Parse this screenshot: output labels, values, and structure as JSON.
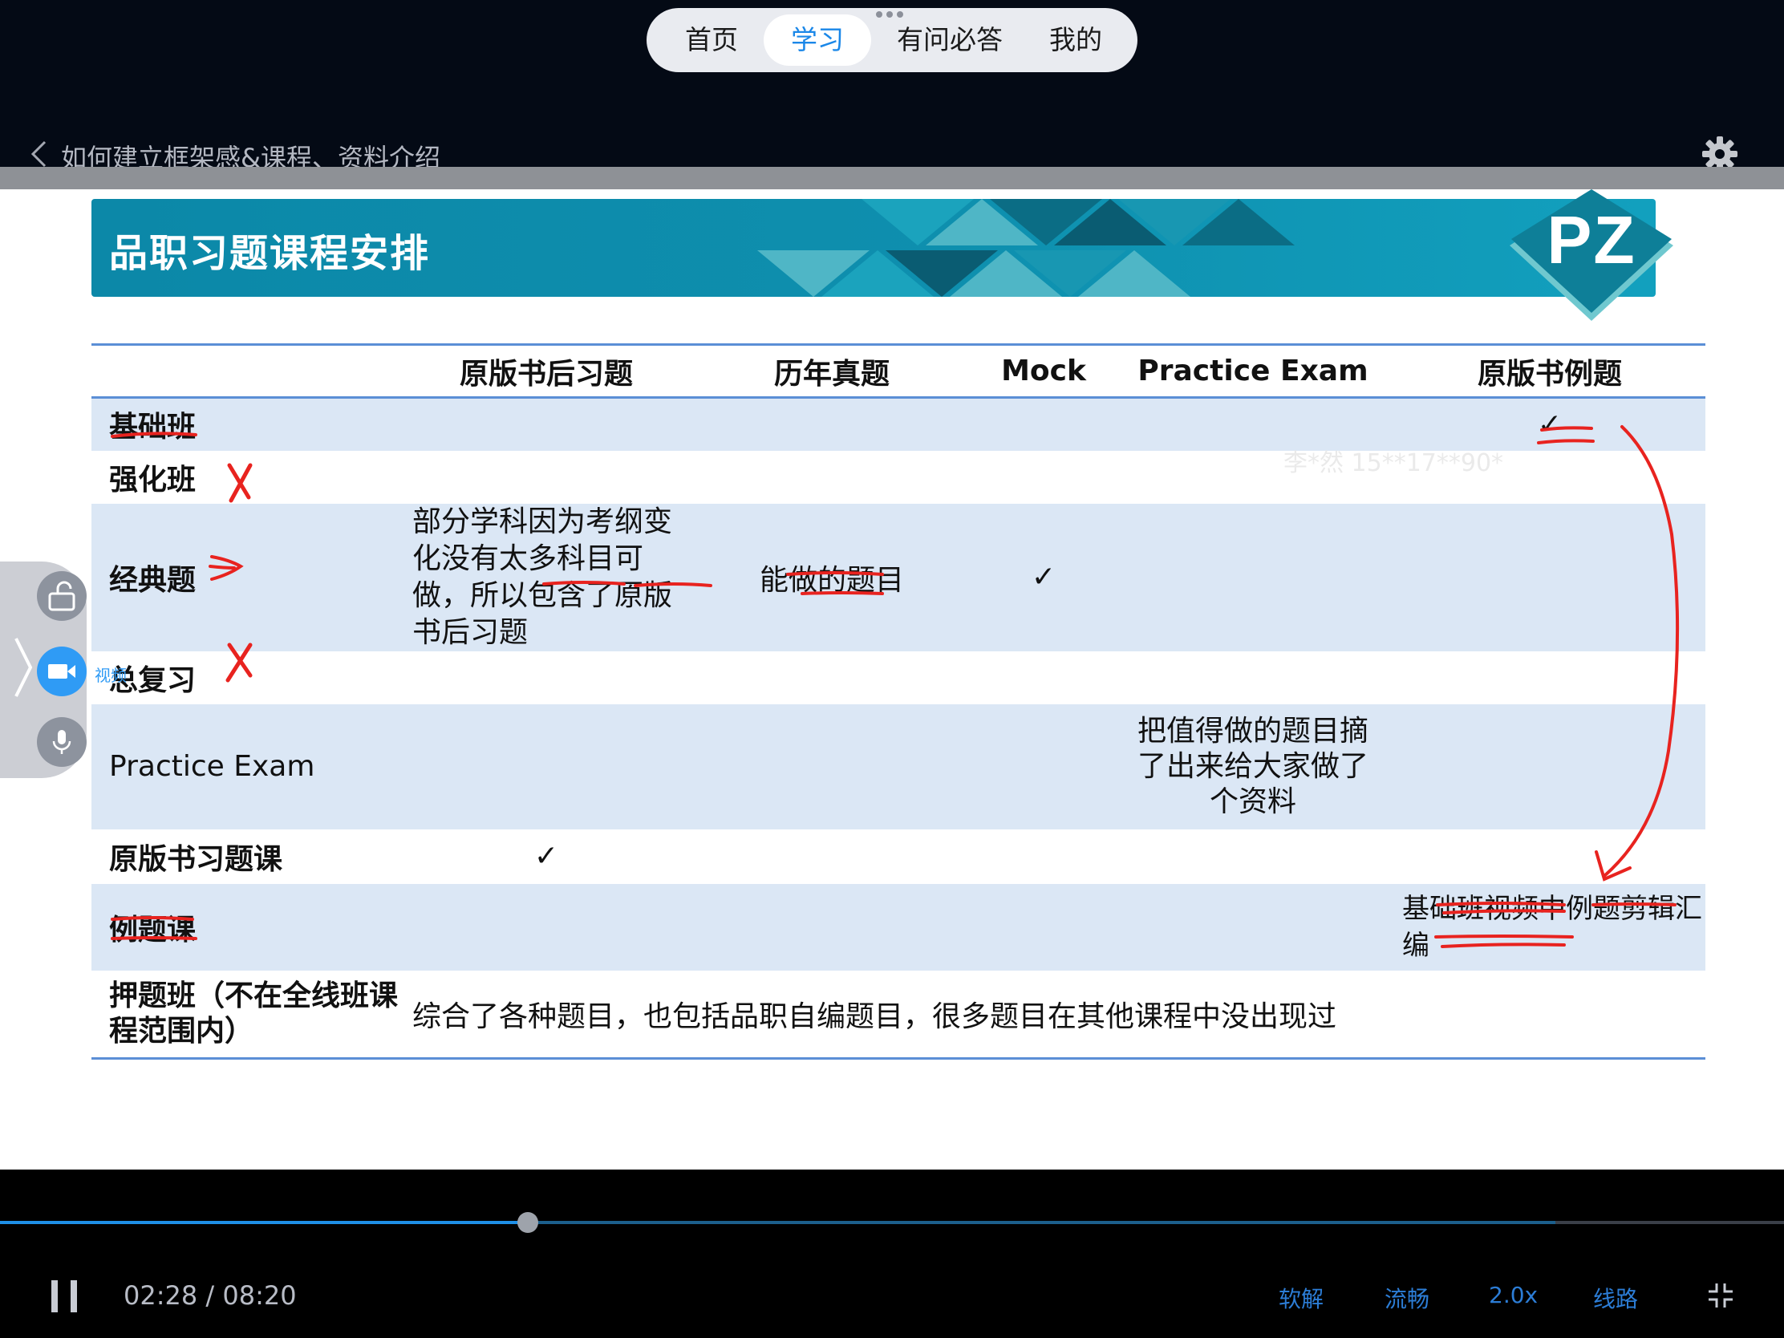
{
  "topnav": {
    "tabs": [
      {
        "label": "首页",
        "active": false
      },
      {
        "label": "学习",
        "active": true
      },
      {
        "label": "有问必答",
        "active": false
      },
      {
        "label": "我的",
        "active": false
      }
    ],
    "active_color": "#1a87e8"
  },
  "header": {
    "title": "如何建立框架感&课程、资料介绍",
    "back_icon": "chevron-left-icon",
    "settings_icon": "gear-icon"
  },
  "slide": {
    "banner_title": "品职习题课程安排",
    "logo_text": "PZ",
    "watermark": "李*然 15**17**90*",
    "columns": [
      "",
      "原版书后习题",
      "历年真题",
      "Mock",
      "Practice Exam",
      "原版书例题"
    ],
    "rows": [
      {
        "label": "基础班",
        "cells": [
          "",
          "",
          "",
          "",
          "✓"
        ]
      },
      {
        "label": "强化班",
        "cells": [
          "",
          "",
          "",
          "",
          ""
        ]
      },
      {
        "label": "经典题",
        "cells": [
          "部分学科因为考纲变化没有太多科目可做，所以包含了原版书后习题",
          "能做的题目",
          "✓",
          "",
          ""
        ]
      },
      {
        "label": "总复习",
        "cells": [
          "",
          "",
          "",
          "",
          ""
        ]
      },
      {
        "label": "Practice Exam",
        "cells": [
          "",
          "",
          "",
          "把值得做的题目摘了出来给大家做了个资料",
          ""
        ]
      },
      {
        "label": "原版书习题课",
        "cells": [
          "✓",
          "",
          "",
          "",
          ""
        ]
      },
      {
        "label": "例题课",
        "cells": [
          "",
          "",
          "",
          "",
          "基础班视频中例题剪辑汇编"
        ]
      },
      {
        "label": "押题班（不在全线班课程范围内）",
        "cells": [
          "综合了各种题目，也包括品职自编题目，很多题目在其他课程中没出现过"
        ]
      }
    ],
    "annotation_color": "#e8231f",
    "accent_color": "#0e8fae"
  },
  "sidetools": {
    "video_label": "视频",
    "icons": [
      "unlock-icon",
      "video-camera-icon",
      "microphone-icon"
    ]
  },
  "player": {
    "time": "02:28 / 08:20",
    "progress": 0.296,
    "buffered": 0.872,
    "controls": {
      "definition": "软解",
      "quality": "流畅",
      "speed": "2.0x",
      "route": "线路"
    },
    "control_color": "#2c7dd6"
  }
}
